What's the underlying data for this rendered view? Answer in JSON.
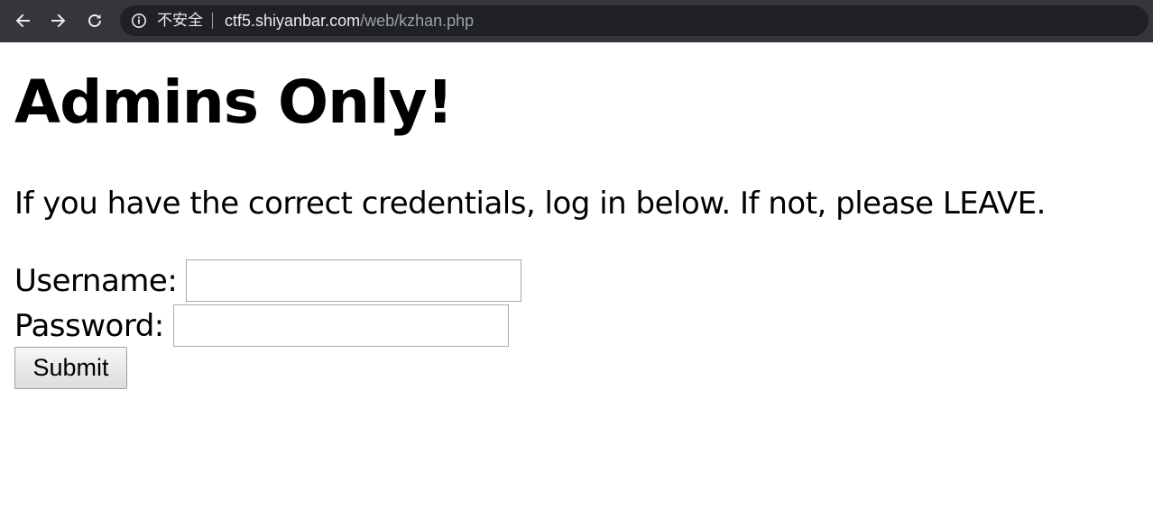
{
  "browser": {
    "security_label": "不安全",
    "url_host": "ctf5.shiyanbar.com",
    "url_path": "/web/kzhan.php",
    "colors": {
      "toolbar_bg": "#35363a",
      "omnibox_bg": "#202124",
      "url_host": "#e8eaed",
      "url_path": "#9aa0a6"
    }
  },
  "page": {
    "title": "Admins Only!",
    "intro": "If you have the correct credentials, log in below. If not, please LEAVE.",
    "form": {
      "username_label": "Username:",
      "username_value": "",
      "password_label": "Password:",
      "password_value": "",
      "submit_label": "Submit"
    }
  }
}
